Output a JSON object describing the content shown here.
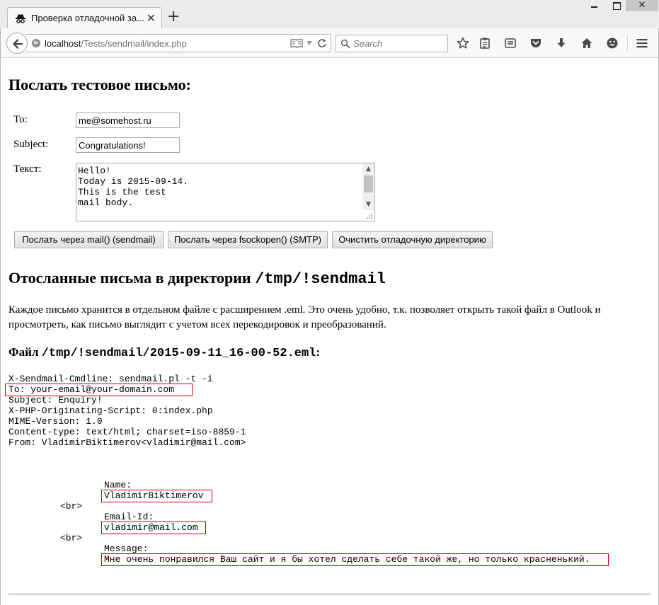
{
  "browser": {
    "tab_title": "Проверка отладочной за...",
    "new_tab_label": "+",
    "close_tab_label": "✕",
    "window_close_label": "✕",
    "url_host": "localhost",
    "url_path": "/Tests/sendmail/index.php",
    "search_placeholder": "Search"
  },
  "page": {
    "send_heading": "Послать тестовое письмо:",
    "form": {
      "to_label": "To:",
      "to_value": "me@somehost.ru",
      "subject_label": "Subject:",
      "subject_value": "Congratulations!",
      "text_label": "Текст:",
      "text_value": "Hello!\nToday is 2015-09-14.\nThis is the test\nmail body."
    },
    "buttons": {
      "send_mail": "Послать через mail() (sendmail)",
      "send_fsockopen": "Послать через fsockopen() (SMTP)",
      "clear_dir": "Очистить отладочную директорию"
    },
    "sent_heading_text": "Отосланные письма в директории ",
    "sent_heading_dir": "/tmp/!sendmail",
    "description": "Каждое письмо хранится в отдельном файле с расширением .eml. Это очень удобно, т.к. позволяет открыть такой файл в Outlook и просмотреть, как письмо выглядит с учетом всех перекодировок и преобразований.",
    "file_heading_text": "Файл ",
    "file_heading_path": "/tmp/!sendmail/2015-09-11_16-00-52.eml",
    "file_heading_colon": ":",
    "email_headers": [
      "X-Sendmail-Cmdline: sendmail.pl -t -i",
      "To: your-email@your-domain.com",
      "Subject: Enquiry!",
      "X-PHP-Originating-Script: 0:index.php",
      "MIME-Version: 1.0",
      "Content-type: text/html; charset=iso-8859-1",
      "From: VladimirBiktimerov<vladimir@mail.com>"
    ],
    "email_body": {
      "name_label": "Name:",
      "name_value": "VladimirBiktimerov",
      "br1": "<br>",
      "email_label": "Email-Id:",
      "email_value": "vladimir@mail.com",
      "br2": "<br>",
      "message_label": "Message:",
      "message_value": "Мне очень понравился Ваш сайт и я бы хотел сделать себе такой же, но только красненький."
    }
  },
  "colors": {
    "highlight_border": "#d40000",
    "chrome_background": "#ebebeb",
    "toolbar_background": "#f9f9fa"
  },
  "icons": {
    "tab": "spy-favicon",
    "back": "back-arrow-icon",
    "site": "globe-icon",
    "reader": "reader-view-icon",
    "history": "dropdown-arrow-icon",
    "reload": "reload-icon",
    "search": "search-icon",
    "bookmark": "star-icon",
    "reading_list": "clipboard-icon",
    "synced": "synced-tabs-icon",
    "pocket": "pocket-icon",
    "download": "download-icon",
    "home": "home-icon",
    "social": "smiley-icon",
    "menu": "hamburger-menu-icon"
  }
}
